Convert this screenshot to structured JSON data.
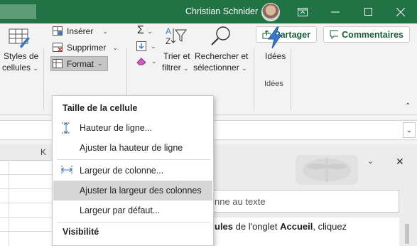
{
  "titlebar": {
    "user_name": "Christian Schnider",
    "accent_color": "#217346"
  },
  "ribbon": {
    "share_label": "Partager",
    "comments_label": "Commentaires",
    "cell_styles": [
      "Styles de",
      "cellules"
    ],
    "insert_label": "Insérer",
    "delete_label": "Supprimer",
    "format_label": "Format",
    "sort_filter": [
      "Trier et",
      "filtrer"
    ],
    "find_select": [
      "Rechercher et",
      "sélectionner"
    ],
    "ideas_label": "Idées",
    "ideas_group": "Idées",
    "sigma_symbol": "Σ"
  },
  "grid": {
    "column_header": "K"
  },
  "format_menu": {
    "cell_size_heading": "Taille de la cellule",
    "row_height": "Hauteur de ligne...",
    "autofit_row_height": "Ajuster la hauteur de ligne",
    "column_width": "Largeur de colonne...",
    "autofit_column_width": "Ajuster la largeur des colonnes",
    "default_width": "Largeur par défaut...",
    "visibility_heading": "Visibilité"
  },
  "help_pane": {
    "search_text": "nne au texte",
    "body_bold_1": "ules",
    "body_text_1": " de l'onglet ",
    "body_bold_2": "Accueil",
    "body_text_2": ", cliquez"
  }
}
